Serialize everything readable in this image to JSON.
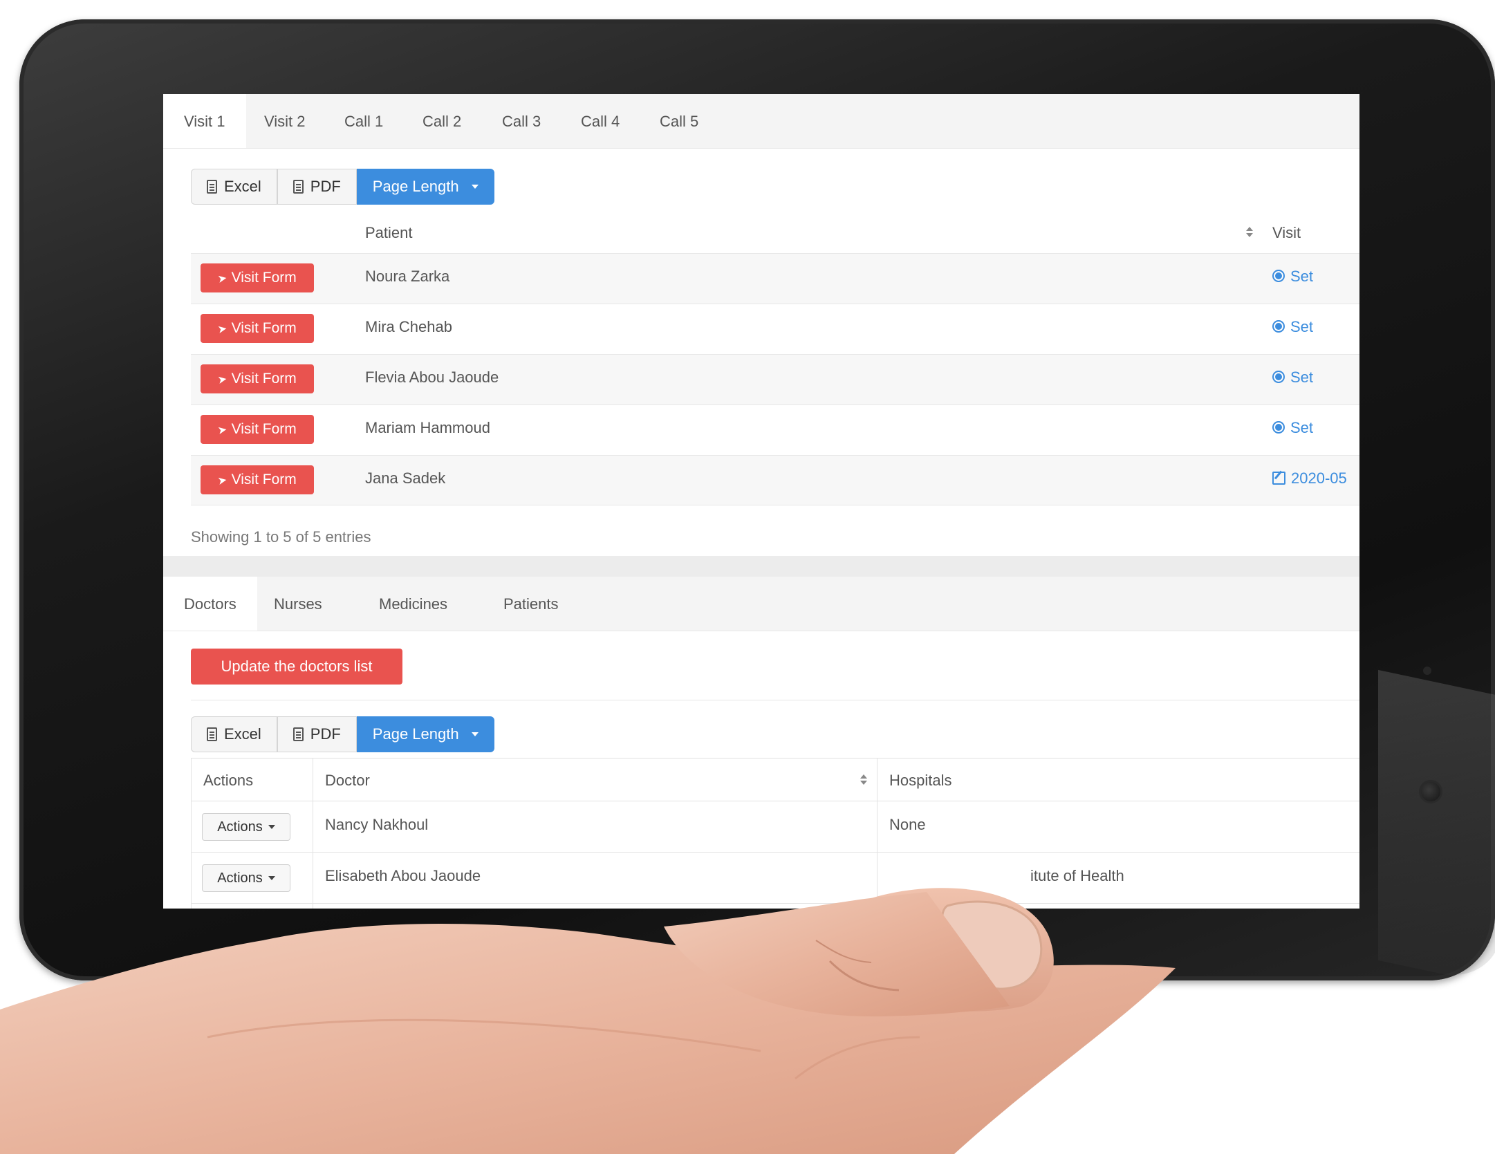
{
  "visit_tabs": [
    "Visit 1",
    "Visit 2",
    "Call 1",
    "Call 2",
    "Call 3",
    "Call 4",
    "Call 5"
  ],
  "export": {
    "excel": "Excel",
    "pdf": "PDF",
    "page_length": "Page Length"
  },
  "patients_table": {
    "headers": {
      "patient": "Patient",
      "visit": "Visit"
    },
    "button_label": "Visit Form",
    "rows": [
      {
        "patient": "Noura Zarka",
        "visit": "Set",
        "visit_icon": "gear-icon"
      },
      {
        "patient": "Mira Chehab",
        "visit": "Set",
        "visit_icon": "gear-icon"
      },
      {
        "patient": "Flevia Abou Jaoude",
        "visit": "Set",
        "visit_icon": "gear-icon"
      },
      {
        "patient": "Mariam Hammoud",
        "visit": "Set",
        "visit_icon": "gear-icon"
      },
      {
        "patient": "Jana Sadek",
        "visit": "2020-05",
        "visit_icon": "edit-icon"
      }
    ],
    "info": "Showing 1 to 5 of 5 entries"
  },
  "list_tabs": [
    "Doctors",
    "Nurses",
    "Medicines",
    "Patients"
  ],
  "update_button": "Update the doctors list",
  "doctors_table": {
    "headers": {
      "actions": "Actions",
      "doctor": "Doctor",
      "hospitals": "Hospitals"
    },
    "action_label": "Actions",
    "rows": [
      {
        "doctor": "Nancy Nakhoul",
        "hospitals": "None"
      },
      {
        "doctor": "Elisabeth Abou Jaoude",
        "hospitals": "itute of Health"
      }
    ]
  },
  "colors": {
    "primary": "#3c8dde",
    "danger": "#e9534f",
    "device": "#1a1a1a"
  }
}
